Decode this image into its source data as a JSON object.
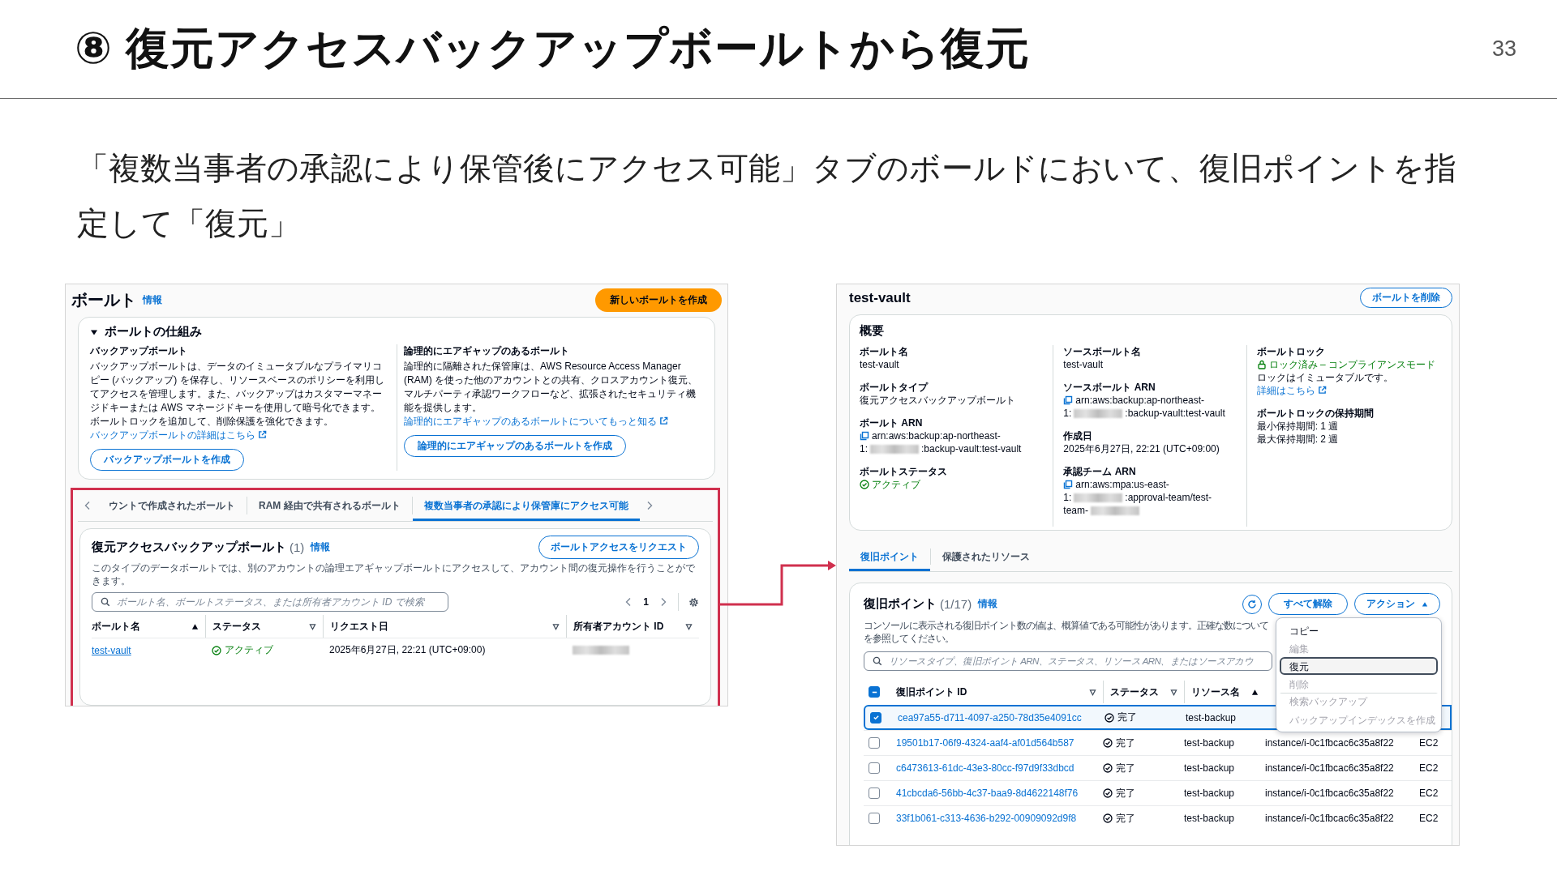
{
  "slide": {
    "title": "⑧ 復元アクセスバックアップボールトから復元",
    "page_number": "33",
    "body": "「複数当事者の承認により保管後にアクセス可能」タブのボールドにおいて、復旧ポイントを指定して「復元」"
  },
  "vaults_screen": {
    "title": "ボールト",
    "info": "情報",
    "create_button": "新しいボールトを作成",
    "how_it_works": {
      "title": "ボールトの仕組み",
      "expanded": true,
      "columns": [
        {
          "heading": "バックアップボールト",
          "text": "バックアップボールトは、データのイミュータブルなプライマリコピー (バックアップ) を保存し、リソースベースのポリシーを利用してアクセスを管理します。また、バックアップはカスタマーマネージドキーまたは AWS マネージドキーを使用して暗号化できます。ボールトロックを追加して、削除保護を強化できます。",
          "link": "バックアップボールトの詳細はこちら",
          "button": "バックアップボールトを作成"
        },
        {
          "heading": "論理的にエアギャップのあるボールト",
          "text": "論理的に隔離された保管庫は、AWS Resource Access Manager (RAM) を使った他のアカウントとの共有、クロスアカウント復元、マルチパーティ承認ワークフローなど、拡張されたセキュリティ機能を提供します。",
          "link": "論理的にエアギャップのあるボールトについてもっと知る",
          "button": "論理的にエアギャップのあるボールトを作成"
        }
      ]
    },
    "tabs": [
      {
        "label": "ウントで作成されたボールト",
        "selected": false
      },
      {
        "label": "RAM 経由で共有されるボールト",
        "selected": false
      },
      {
        "label": "複数当事者の承認により保管庫にアクセス可能",
        "selected": true
      }
    ],
    "table_panel": {
      "title": "復元アクセスバックアップボールト",
      "count": "(1)",
      "info": "情報",
      "request_button": "ボールトアクセスをリクエスト",
      "description": "このタイプのデータボールトでは、別のアカウントの論理エアギャップボールトにアクセスして、アカウント間の復元操作を行うことができます。",
      "search": {
        "placeholder": "ボールト名、ボールトステータス、または所有者アカウント ID で検索"
      },
      "page": "1",
      "columns": [
        {
          "label": "ボールト名",
          "sorted": true
        },
        {
          "label": "ステータス",
          "sorted": false
        },
        {
          "label": "リクエスト日",
          "sorted": false
        },
        {
          "label": "所有者アカウント ID",
          "sorted": false
        }
      ],
      "rows": [
        {
          "name": "test-vault",
          "status": "アクティブ",
          "request_date": "2025年6月27日, 22:21 (UTC+09:00)"
        }
      ]
    }
  },
  "vault_detail_screen": {
    "title": "test-vault",
    "delete_button": "ボールトを削除",
    "overview": {
      "title": "概要",
      "columns": [
        [
          {
            "label": "ボールト名",
            "kind": "text",
            "value": "test-vault"
          },
          {
            "label": "ボールトタイプ",
            "kind": "text",
            "value": "復元アクセスバックアップボールト"
          },
          {
            "label": "ボールト ARN",
            "kind": "arn",
            "lines": [
              [
                {
                  "text": "arn:aws:backup:ap-northeast-"
                }
              ],
              [
                {
                  "text": "1:"
                },
                {
                  "redacted": true
                },
                {
                  "text": ":backup-vault:test-vault"
                }
              ]
            ]
          },
          {
            "label": "ボールトステータス",
            "kind": "status",
            "value": "アクティブ"
          }
        ],
        [
          {
            "label": "ソースボールト名",
            "kind": "text",
            "value": "test-vault"
          },
          {
            "label": "ソースボールト ARN",
            "kind": "arn",
            "lines": [
              [
                {
                  "text": "arn:aws:backup:ap-northeast-"
                }
              ],
              [
                {
                  "text": "1:"
                },
                {
                  "redacted": true
                },
                {
                  "text": ":backup-vault:test-vault"
                }
              ]
            ]
          },
          {
            "label": "作成日",
            "kind": "text",
            "value": "2025年6月27日, 22:21 (UTC+09:00)"
          },
          {
            "label": "承認チーム ARN",
            "kind": "arn",
            "lines": [
              [
                {
                  "text": "arn:aws:mpa:us-east-"
                }
              ],
              [
                {
                  "text": "1:"
                },
                {
                  "redacted": true
                },
                {
                  "text": ":approval-team/test-"
                }
              ],
              [
                {
                  "text": "team-"
                },
                {
                  "redacted": true
                }
              ]
            ]
          }
        ],
        [
          {
            "label": "ボールトロック",
            "kind": "lock",
            "value": "ロック済み – コンプライアンスモード",
            "note": "ロックはイミュータブルです。",
            "link": "詳細はこちら"
          },
          {
            "label": "ボールトロックの保持期間",
            "kind": "lines",
            "lines": [
              "最小保持期間: 1 週",
              "最大保持期間: 2 週"
            ]
          }
        ]
      ]
    },
    "tabs": [
      {
        "label": "復旧ポイント",
        "selected": true
      },
      {
        "label": "保護されたリソース",
        "selected": false
      }
    ],
    "recovery_points": {
      "title": "復旧ポイント",
      "count": "(1/17)",
      "info": "情報",
      "clear_button": "すべて解除",
      "actions_button": "アクション",
      "actions_expanded": true,
      "description_lines": [
        "コンソールに表示される復旧ポイント数の値は、概算値である可能性があります。正確な数について",
        "を参照してください。"
      ],
      "search": {
        "placeholder": "リソースタイプ、復旧ポイント ARN、ステータス、リソース ARN、またはソースアカウ"
      },
      "header_indeterminate": true,
      "columns": [
        {
          "label": "復旧ポイント ID",
          "sorted": false
        },
        {
          "label": "ステータス",
          "sorted": false
        },
        {
          "label": "リソース名",
          "sorted": true
        }
      ],
      "rows": [
        {
          "id": "cea97a55-d711-4097-a250-78d35e4091cc",
          "status": "完了",
          "resource": "test-backup",
          "selected": true
        },
        {
          "id": "19501b17-06f9-4324-aaf4-af01d564b587",
          "status": "完了",
          "resource": "test-backup",
          "resource_arn": "instance/i-0c1fbcac6c35a8f22",
          "type": "EC2",
          "selected": false
        },
        {
          "id": "c6473613-61dc-43e3-80cc-f97d9f33dbcd",
          "status": "完了",
          "resource": "test-backup",
          "resource_arn": "instance/i-0c1fbcac6c35a8f22",
          "type": "EC2",
          "selected": false
        },
        {
          "id": "41cbcda6-56bb-4c37-baa9-8d4622148f76",
          "status": "完了",
          "resource": "test-backup",
          "resource_arn": "instance/i-0c1fbcac6c35a8f22",
          "type": "EC2",
          "selected": false
        },
        {
          "id": "33f1b061-c313-4636-b292-00909092d9f8",
          "status": "完了",
          "resource": "test-backup",
          "resource_arn": "instance/i-0c1fbcac6c35a8f22",
          "type": "EC2",
          "selected": false
        }
      ],
      "menu": [
        {
          "label": "コピー",
          "disabled": false,
          "selected": false,
          "separated": false
        },
        {
          "label": "編集",
          "disabled": true,
          "selected": false,
          "separated": false
        },
        {
          "label": "復元",
          "disabled": false,
          "selected": true,
          "separated": false
        },
        {
          "label": "削除",
          "disabled": true,
          "selected": false,
          "separated": false
        },
        {
          "label": "検索バックアップ",
          "disabled": true,
          "selected": false,
          "separated": true
        },
        {
          "label": "バックアップインデックスを作成",
          "disabled": true,
          "selected": false,
          "separated": false
        }
      ]
    }
  }
}
